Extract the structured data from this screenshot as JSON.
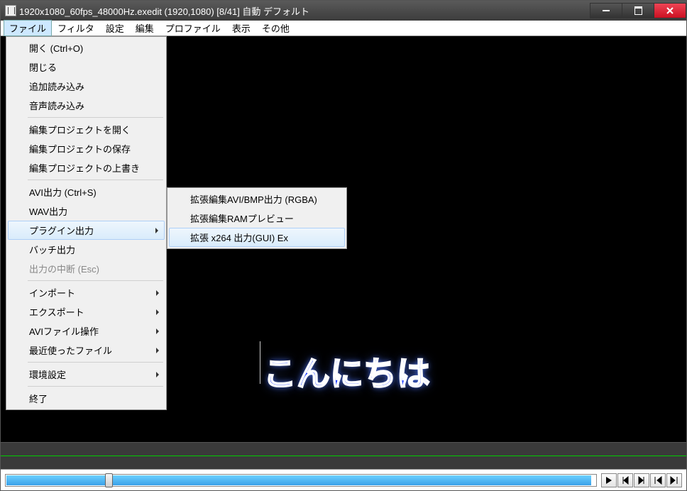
{
  "titlebar": {
    "text": "1920x1080_60fps_48000Hz.exedit (1920,1080) [8/41] 自動 デフォルト"
  },
  "menubar": {
    "items": [
      "ファイル",
      "フィルタ",
      "設定",
      "編集",
      "プロファイル",
      "表示",
      "その他"
    ]
  },
  "file_menu": {
    "open": "開く (Ctrl+O)",
    "close": "閉じる",
    "append_read": "追加読み込み",
    "audio_read": "音声読み込み",
    "edit_project_open": "編集プロジェクトを開く",
    "edit_project_save": "編集プロジェクトの保存",
    "edit_project_overwrite": "編集プロジェクトの上書き",
    "avi_out": "AVI出力 (Ctrl+S)",
    "wav_out": "WAV出力",
    "plugin_out": "プラグイン出力",
    "batch_out": "バッチ出力",
    "abort_out": "出力の中断 (Esc)",
    "import": "インポート",
    "export": "エクスポート",
    "avi_file_ops": "AVIファイル操作",
    "recent_files": "最近使ったファイル",
    "environment": "環境設定",
    "exit": "終了"
  },
  "plugin_submenu": {
    "avi_bmp": "拡張編集AVI/BMP出力 (RGBA)",
    "ram_preview": "拡張編集RAMプレビュー",
    "x264": "拡張 x264 出力(GUI) Ex"
  },
  "preview": {
    "text": "こんにちは"
  }
}
